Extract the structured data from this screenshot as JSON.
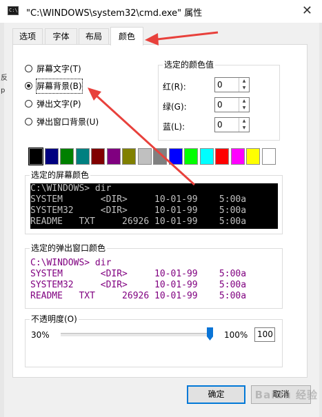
{
  "window": {
    "icon_text": "C:\\",
    "title": "\"C:\\WINDOWS\\system32\\cmd.exe\" 属性",
    "close_glyph": "✕"
  },
  "tabs": [
    {
      "label": "选项",
      "active": false
    },
    {
      "label": "字体",
      "active": false
    },
    {
      "label": "布局",
      "active": false
    },
    {
      "label": "颜色",
      "active": true
    }
  ],
  "color_targets": [
    {
      "label": "屏幕文字(T)",
      "checked": false
    },
    {
      "label": "屏幕背景(B)",
      "checked": true
    },
    {
      "label": "弹出文字(P)",
      "checked": false
    },
    {
      "label": "弹出窗口背景(U)",
      "checked": false
    }
  ],
  "selected_color_values": {
    "title": "选定的颜色值",
    "red": {
      "label": "红(R):",
      "value": "0"
    },
    "green": {
      "label": "绿(G):",
      "value": "0"
    },
    "blue": {
      "label": "蓝(L):",
      "value": "0"
    }
  },
  "palette": [
    "#000000",
    "#000080",
    "#008000",
    "#008080",
    "#800000",
    "#800080",
    "#808000",
    "#c0c0c0",
    "#808080",
    "#0000ff",
    "#00ff00",
    "#00ffff",
    "#ff0000",
    "#ff00ff",
    "#ffff00",
    "#ffffff"
  ],
  "screen_preview": {
    "title": "选定的屏幕颜色",
    "background": "#000000",
    "text_color": "#c0c0c0",
    "lines": [
      "C:\\WINDOWS> dir",
      "SYSTEM       <DIR>     10-01-99    5:00a",
      "SYSTEM32     <DIR>     10-01-99    5:00a",
      "README   TXT     26926 10-01-99    5:00a"
    ]
  },
  "popup_preview": {
    "title": "选定的弹出窗口颜色",
    "background": "#ffffff",
    "text_color": "#800080",
    "lines": [
      "C:\\WINDOWS> dir",
      "SYSTEM       <DIR>     10-01-99    5:00a",
      "SYSTEM32     <DIR>     10-01-99    5:00a",
      "README   TXT     26926 10-01-99    5:00a"
    ]
  },
  "opacity": {
    "title": "不透明度(O)",
    "min_label": "30%",
    "max_label": "100%",
    "value": "100",
    "fraction": 1.0
  },
  "buttons": {
    "ok": "确定",
    "cancel": "取消"
  },
  "annotation_color": "#e8413c",
  "watermark_text": "Baidu 经验",
  "background_window_fragments": [
    "反",
    "p"
  ]
}
